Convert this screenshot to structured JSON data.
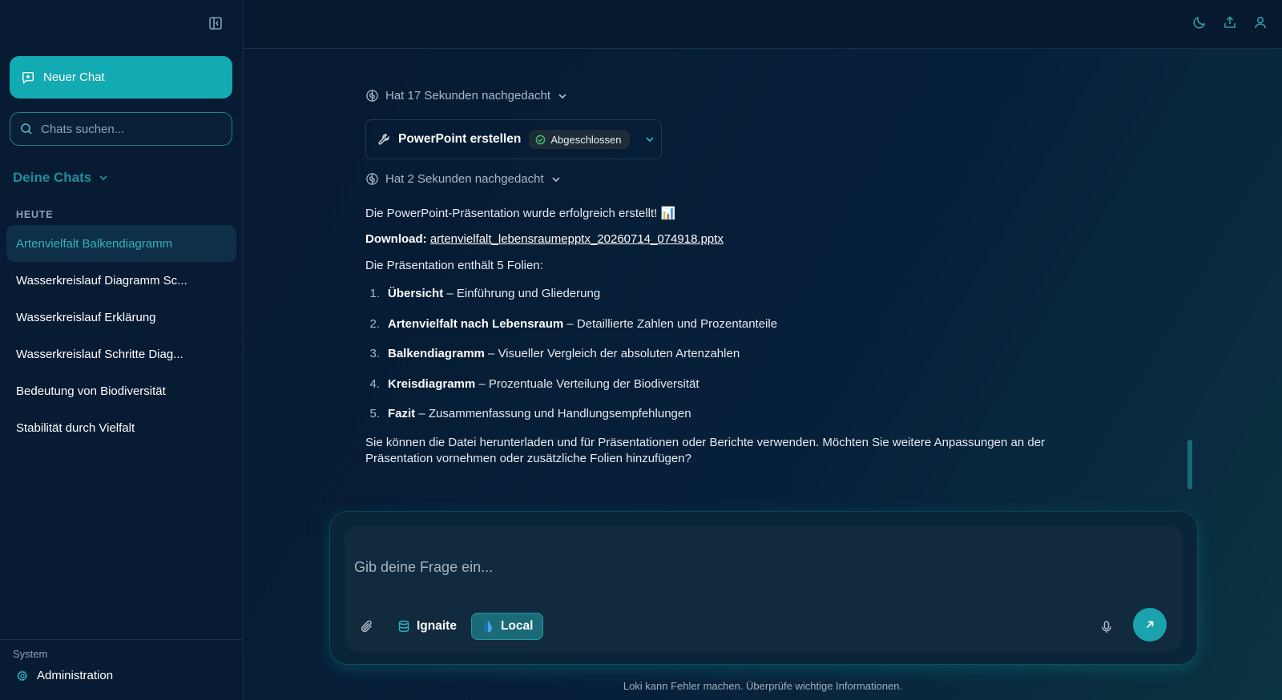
{
  "sidebar": {
    "new_chat_label": "Neuer Chat",
    "search_placeholder": "Chats suchen...",
    "chats_heading": "Deine Chats",
    "group_today": "HEUTE",
    "items": [
      {
        "label": "Artenvielfalt Balkendiagramm"
      },
      {
        "label": "Wasserkreislauf Diagramm Sc..."
      },
      {
        "label": "Wasserkreislauf Erklärung"
      },
      {
        "label": "Wasserkreislauf Schritte Diag..."
      },
      {
        "label": "Bedeutung von Biodiversität"
      },
      {
        "label": "Stabilität durch Vielfalt"
      }
    ],
    "system_label": "System",
    "admin_label": "Administration"
  },
  "topbar": {
    "icons": [
      "moon-icon",
      "share-icon",
      "user-icon"
    ]
  },
  "message": {
    "think1": "Hat 17 Sekunden nachgedacht",
    "tool_title": "PowerPoint erstellen",
    "tool_status": "Abgeschlossen",
    "think2": "Hat 2 Sekunden nachgedacht",
    "line1": "Die PowerPoint-Präsentation wurde erfolgreich erstellt! 📊",
    "download_label": "Download:",
    "download_file": "artenvielfalt_lebensraumepptx_20260714_074918.pptx",
    "intro": "Die Präsentation enthält 5 Folien:",
    "slides": [
      {
        "num": "1.",
        "title": "Übersicht",
        "desc": " – Einführung und Gliederung"
      },
      {
        "num": "2.",
        "title": "Artenvielfalt nach Lebensraum",
        "desc": " – Detaillierte Zahlen und Prozentanteile"
      },
      {
        "num": "3.",
        "title": "Balkendiagramm",
        "desc": " – Visueller Vergleich der absoluten Artenzahlen"
      },
      {
        "num": "4.",
        "title": "Kreisdiagramm",
        "desc": " – Prozentuale Verteilung der Biodiversität"
      },
      {
        "num": "5.",
        "title": "Fazit",
        "desc": " – Zusammenfassung und Handlungsempfehlungen"
      }
    ],
    "closing": "Sie können die Datei herunterladen und für Präsentationen oder Berichte verwenden. Möchten Sie weitere Anpassungen an der Präsentation vornehmen oder zusätzliche Folien hinzufügen?"
  },
  "composer": {
    "placeholder": "Gib deine Frage ein...",
    "source1_label": "Ignaite",
    "source2_label": "Local"
  },
  "disclaimer": "Loki kann Fehler machen. Überprüfe wichtige Informationen.",
  "colors": {
    "accent": "#12aab3",
    "background": "#07192f",
    "status_ok": "#3cc26e"
  }
}
